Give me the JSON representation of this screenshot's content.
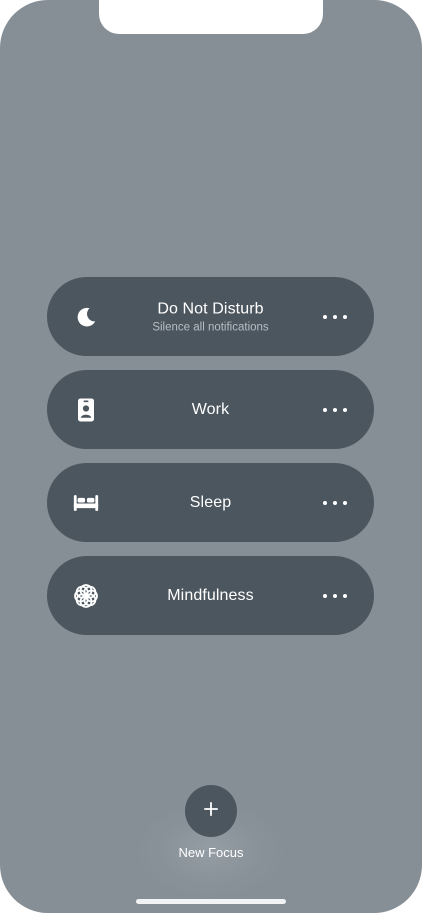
{
  "focus_modes": [
    {
      "title": "Do Not Disturb",
      "subtitle": "Silence all notifications",
      "icon": "moon-icon"
    },
    {
      "title": "Work",
      "subtitle": "",
      "icon": "id-badge-icon"
    },
    {
      "title": "Sleep",
      "subtitle": "",
      "icon": "bed-icon"
    },
    {
      "title": "Mindfulness",
      "subtitle": "",
      "icon": "flower-icon"
    }
  ],
  "new_focus": {
    "label": "New Focus",
    "icon": "plus-icon"
  },
  "colors": {
    "background": "#868e96",
    "card": "#4c565e",
    "text": "#ffffff",
    "subtitle": "#b7bec4"
  }
}
